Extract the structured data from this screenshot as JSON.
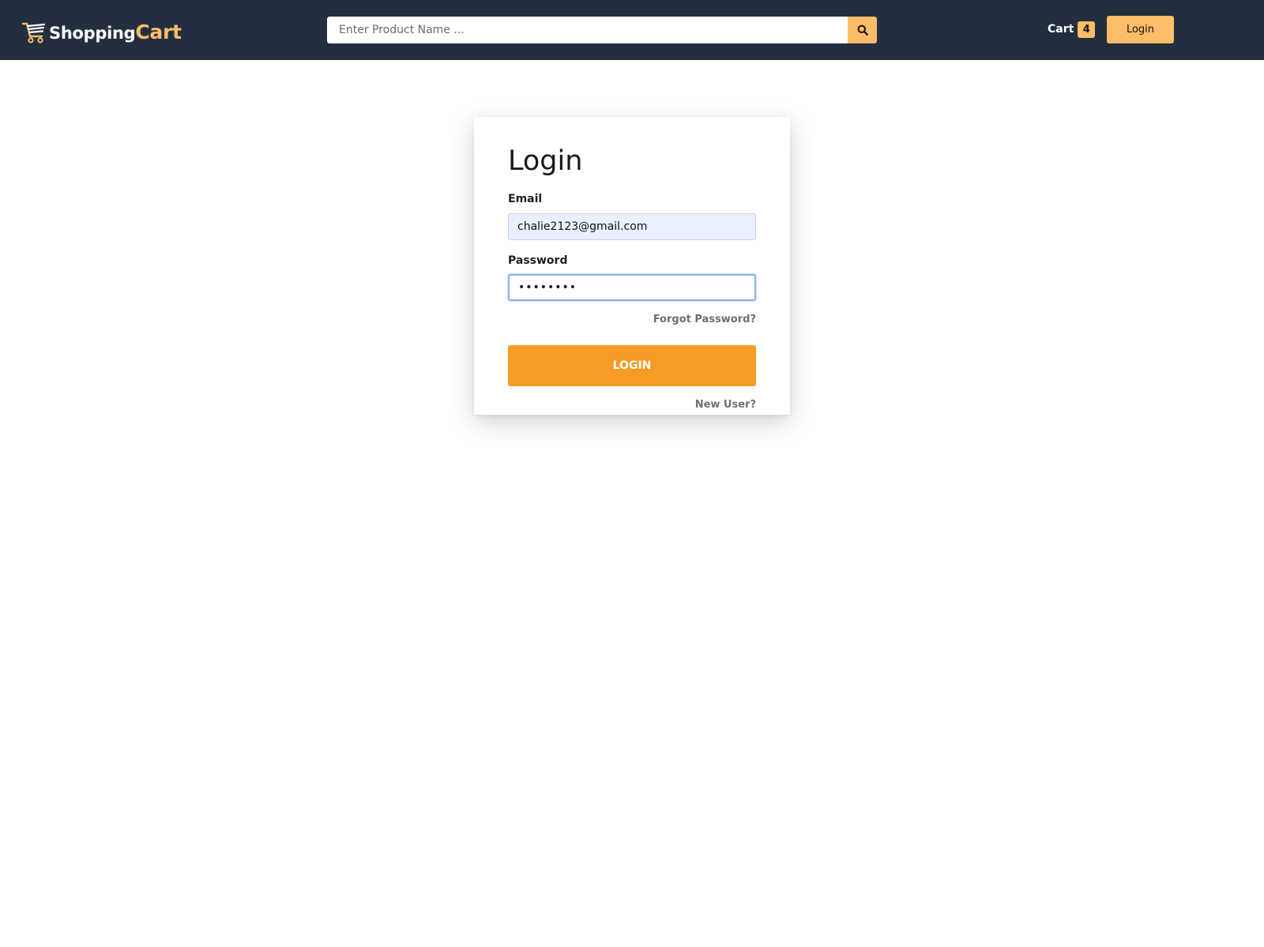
{
  "brand": {
    "name_part1": "Shopping",
    "name_part2": "Cart",
    "accent_color": "#febd69",
    "navbar_color": "#232f3e"
  },
  "search": {
    "placeholder": "Enter Product Name ...",
    "button_icon": "search-icon"
  },
  "nav": {
    "cart_label": "Cart",
    "cart_count": "4",
    "login_label": "Login"
  },
  "login_form": {
    "title": "Login",
    "email_label": "Email",
    "email_value": "chalie2123@gmail.com",
    "password_label": "Password",
    "password_value": "••••••••",
    "forgot_link": "Forgot Password?",
    "submit_label": "LOGIN",
    "new_user_link": "New User?",
    "button_color": "#f89b24"
  }
}
